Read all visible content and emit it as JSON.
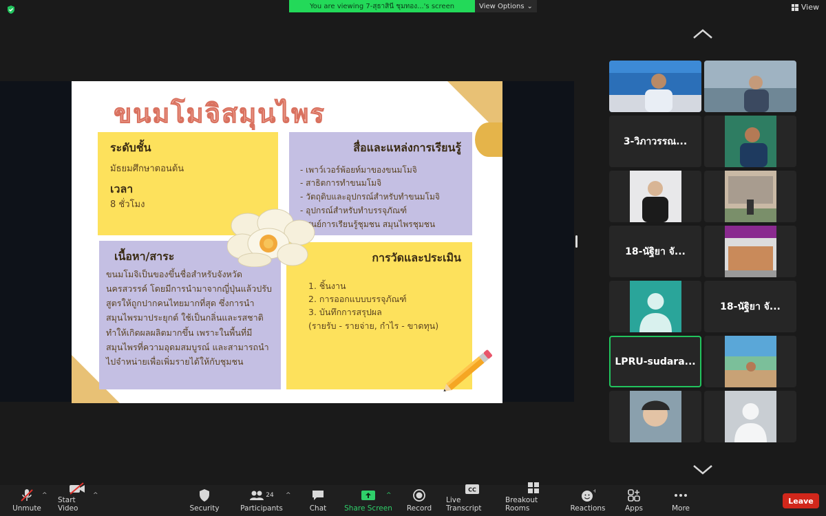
{
  "banner": {
    "text": "You are viewing 7-สุธาสินี ชุมทอง...'s screen",
    "view_options": "View Options"
  },
  "view_button": "View",
  "slide": {
    "title": "ขนมโมจิสมุนไพร",
    "level": {
      "heading": "ระดับชั้น",
      "value": "มัธยมศึกษาตอนต้น",
      "time_heading": "เวลา",
      "time_value": "8 ชั่วโมง"
    },
    "media": {
      "heading": "สื่อและแหล่งการเรียนรู้",
      "items": [
        "- เพาว์เวอร์พ้อยท์มาของขนมโมจิ",
        "- สาธิตการทำขนมโมจิ",
        "- วัตถุดิบและอุปกรณ์สำหรับทำขนมโมจิ",
        "- อุปกรณ์สำหรับทำบรรจุภัณฑ์",
        "- ศูนย์การเรียนรู้ชุมชน สมุนไพรชุมชน"
      ]
    },
    "content": {
      "heading": "เนื้อหา/สาระ",
      "body": "ขนมโมจิเป็นของขึ้นชื่อสำหรับจังหวัดนครสวรรค์ โดยมีการนำมาจากญี่ปุ่นแล้วปรับสูตรให้ถูกปากคนไทยมากที่สุด ซึ่งการนำสมุนไพรมาประยุกต์ ใช้เป็นกลิ่นและรสชาติทำให้เกิดผลผลิตมากขึ้น เพราะในพื้นที่มีสมุนไพรที่ความอุดมสมบูรณ์ และสามารถนำไปจำหน่ายเพื่อเพิ่มรายได้ให้กับชุมชน"
    },
    "evaluation": {
      "heading": "การวัดและประเมิน",
      "items": [
        "1. ชิ้นงาน",
        "2. การออกแบบบรรจุภัณฑ์",
        "3. บันทึกการสรุปผล",
        "(รายรับ - รายจ่าย, กำไร - ขาดทุน)"
      ]
    }
  },
  "participants_tiles": [
    {
      "type": "video",
      "name": ""
    },
    {
      "type": "video",
      "name": ""
    },
    {
      "type": "name",
      "name": "3-วิภาวรรณ..."
    },
    {
      "type": "video",
      "name": ""
    },
    {
      "type": "video",
      "name": ""
    },
    {
      "type": "video",
      "name": ""
    },
    {
      "type": "name",
      "name": "18-นัฐิยา จั..."
    },
    {
      "type": "video",
      "name": ""
    },
    {
      "type": "avatar",
      "name": ""
    },
    {
      "type": "name",
      "name": "18-นัฐิยา จั..."
    },
    {
      "type": "name",
      "name": "LPRU-sudara...",
      "active": true
    },
    {
      "type": "video",
      "name": ""
    },
    {
      "type": "video",
      "name": ""
    },
    {
      "type": "avatar",
      "name": ""
    }
  ],
  "toolbar": {
    "unmute": "Unmute",
    "start_video": "Start Video",
    "security": "Security",
    "participants": "Participants",
    "participants_count": "24",
    "chat": "Chat",
    "share_screen": "Share Screen",
    "record": "Record",
    "live_transcript": "Live Transcript",
    "breakout_rooms": "Breakout Rooms",
    "reactions": "Reactions",
    "apps": "Apps",
    "more": "More",
    "leave": "Leave"
  },
  "colors": {
    "banner": "#23d959",
    "leave": "#d1271b",
    "active_border": "#22c55e",
    "share_green": "#2fd06a"
  }
}
